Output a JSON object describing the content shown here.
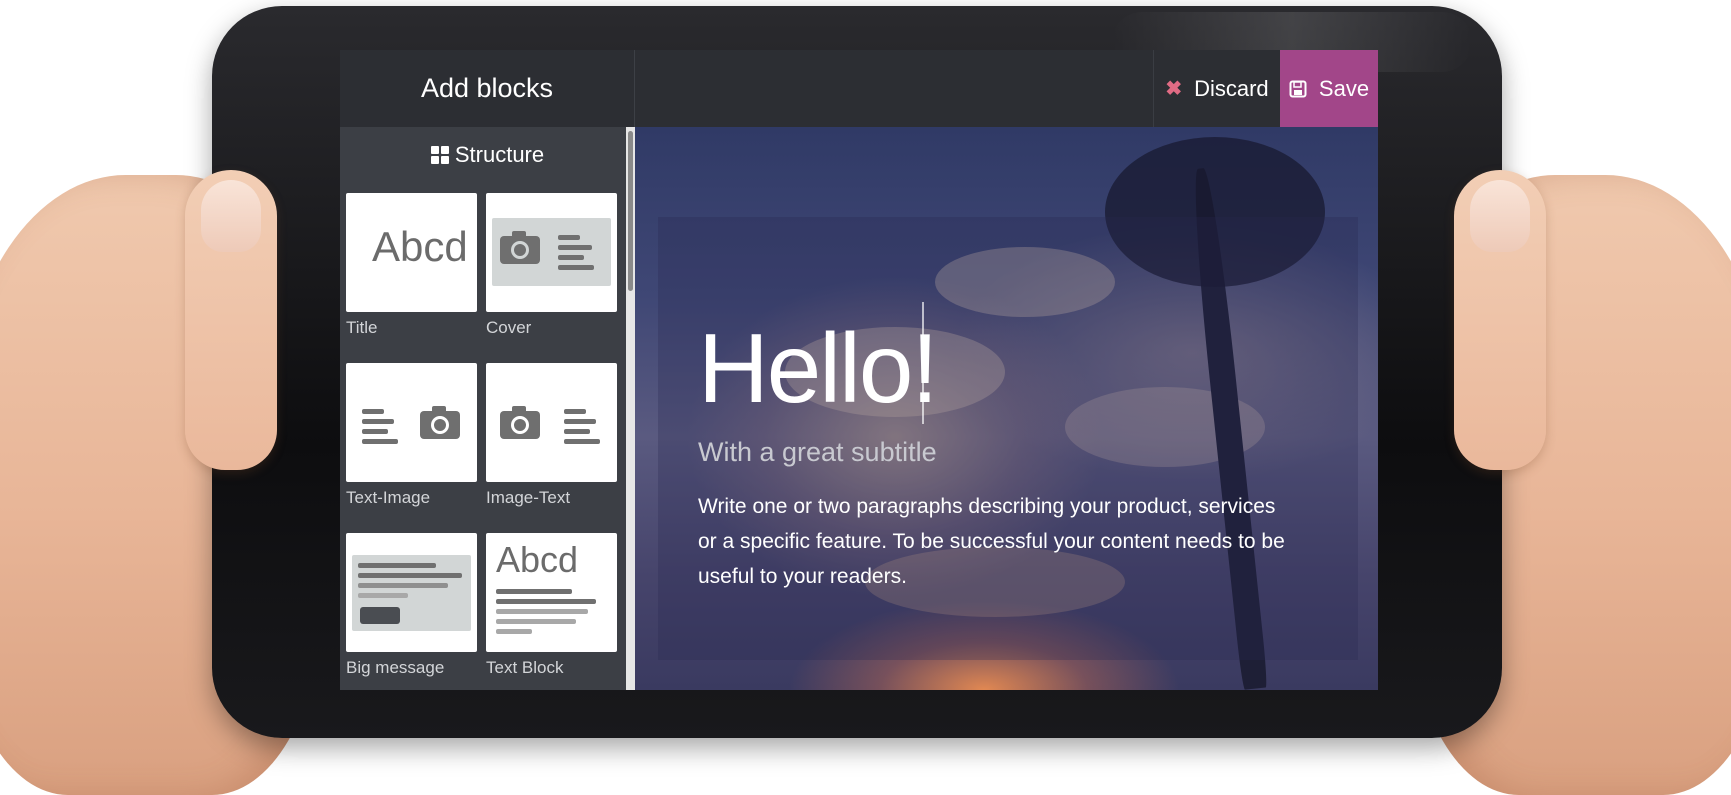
{
  "sidebar": {
    "title": "Add blocks",
    "section": "Structure",
    "blocks": [
      {
        "label": "Title",
        "icon": "abcd-title-thumbnail"
      },
      {
        "label": "Cover",
        "icon": "camera-text-thumbnail"
      },
      {
        "label": "Text-Image",
        "icon": "text-camera-thumbnail"
      },
      {
        "label": "Image-Text",
        "icon": "camera-text-thumbnail"
      },
      {
        "label": "Big message",
        "icon": "message-thumbnail"
      },
      {
        "label": "Text Block",
        "icon": "abcd-textblock-thumbnail"
      }
    ],
    "thumbnail_text": "Abcd"
  },
  "toolbar": {
    "discard_label": "Discard",
    "save_label": "Save",
    "save_color": "#a24689",
    "discard_icon_color": "#e06b84"
  },
  "content": {
    "title": "Hello!",
    "subtitle": "With a great subtitle",
    "paragraph": "Write one or two paragraphs describing your product, services or a specific feature. To be successful your content needs to be useful to your readers."
  }
}
